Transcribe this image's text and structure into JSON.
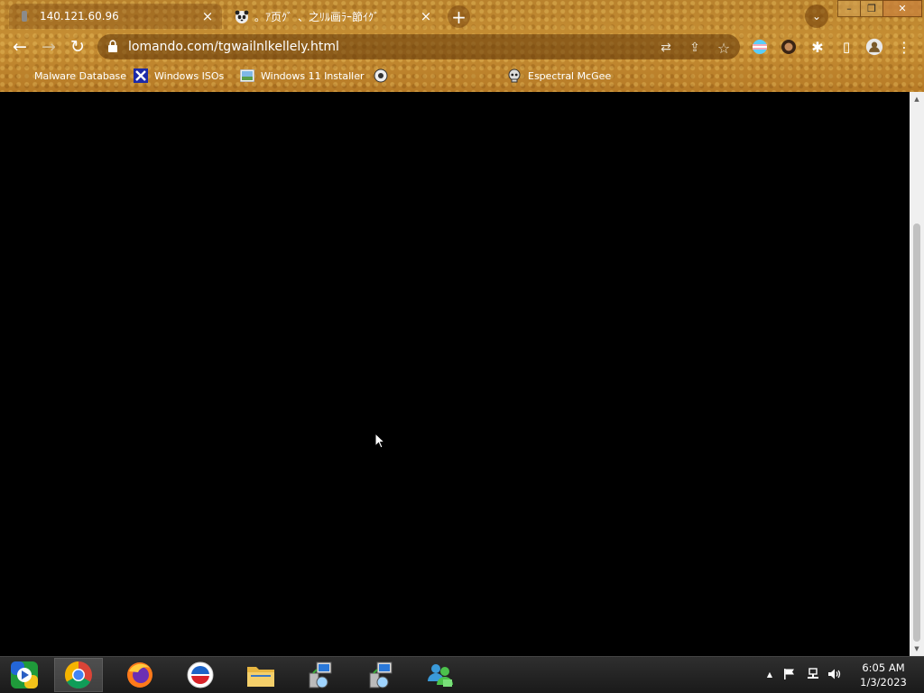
{
  "tabs": [
    {
      "title": "140.121.60.96",
      "close": "×",
      "active": true
    },
    {
      "title": "。ｱ页ｸ゛、之ﾘﾙ画ﾗｰ節ｲｸ゛",
      "close": "×",
      "active": false
    }
  ],
  "new_tab_label": "+",
  "tab_search_glyph": "⌄",
  "window_controls": {
    "minimize": "–",
    "restore": "❐",
    "close": "✕"
  },
  "nav": {
    "back": "←",
    "forward": "→",
    "reload": "↻"
  },
  "address_bar": {
    "url": "lomando.com/tgwailnlkellely.html"
  },
  "omnibox_icons": {
    "translate": "⇄",
    "share": "⇪",
    "star": "☆"
  },
  "toolbar_icons": {
    "extensions": "✱",
    "sidepanel": "▯",
    "menu": "⋮"
  },
  "bookmarks": [
    {
      "label": "Malware Database"
    },
    {
      "label": "Windows ISOs"
    },
    {
      "label": "Windows 11 Installer"
    },
    {
      "label": ""
    },
    {
      "label": "Espectral McGee"
    }
  ],
  "taskbar": {
    "apps": [
      "windows-media-center",
      "chrome",
      "firefox",
      "opera",
      "file-explorer",
      "network-install-1",
      "network-install-2",
      "messenger"
    ]
  },
  "tray": {
    "show_hidden": "▲"
  },
  "clock": {
    "time": "6:05 AM",
    "date": "1/3/2023"
  },
  "colors": {
    "chrome_frame": "#c78f34",
    "page_background": "#000000",
    "taskbar": "#1f1f1f"
  }
}
